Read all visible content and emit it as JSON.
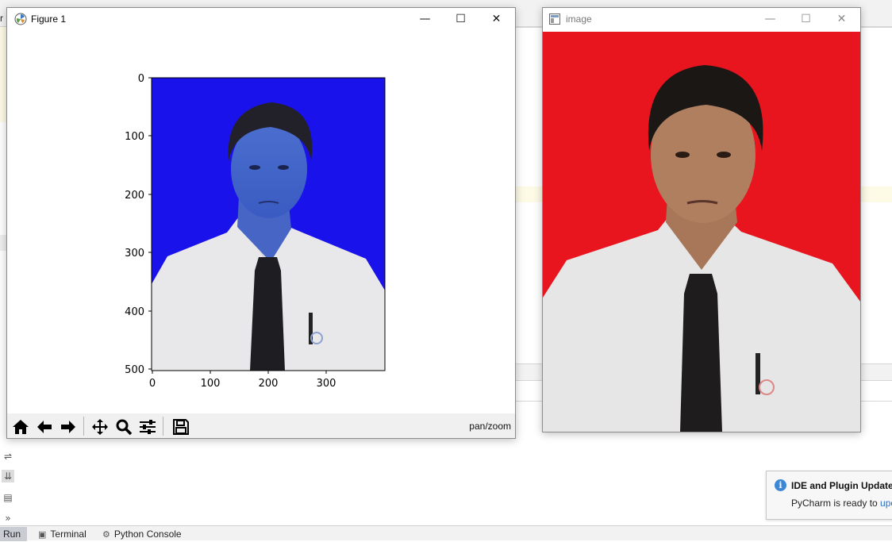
{
  "ide": {
    "title_fragment": "r",
    "bottom_tabs": {
      "run_label": "Run",
      "terminal_label": "Terminal",
      "python_console_label": "Python Console"
    },
    "notification": {
      "title": "IDE and Plugin Updates",
      "body_prefix": "PyCharm is ready to ",
      "body_link": "upc"
    }
  },
  "figure_window": {
    "title": "Figure 1",
    "status": "pan/zoom",
    "axes": {
      "yticks": [
        "0",
        "100",
        "200",
        "300",
        "400",
        "500"
      ],
      "xticks": [
        "0",
        "100",
        "200",
        "300"
      ]
    },
    "toolbar": [
      {
        "name": "home-button",
        "icon": "home-icon"
      },
      {
        "name": "back-button",
        "icon": "arrow-left-icon"
      },
      {
        "name": "forward-button",
        "icon": "arrow-right-icon"
      },
      {
        "name": "pan-button",
        "icon": "move-icon"
      },
      {
        "name": "zoom-button",
        "icon": "magnifier-icon"
      },
      {
        "name": "configure-subplots-button",
        "icon": "sliders-icon"
      },
      {
        "name": "save-button",
        "icon": "floppy-icon"
      }
    ],
    "image_background": "#1a12ea"
  },
  "image_window": {
    "title": "image",
    "image_background": "#e8141e"
  }
}
